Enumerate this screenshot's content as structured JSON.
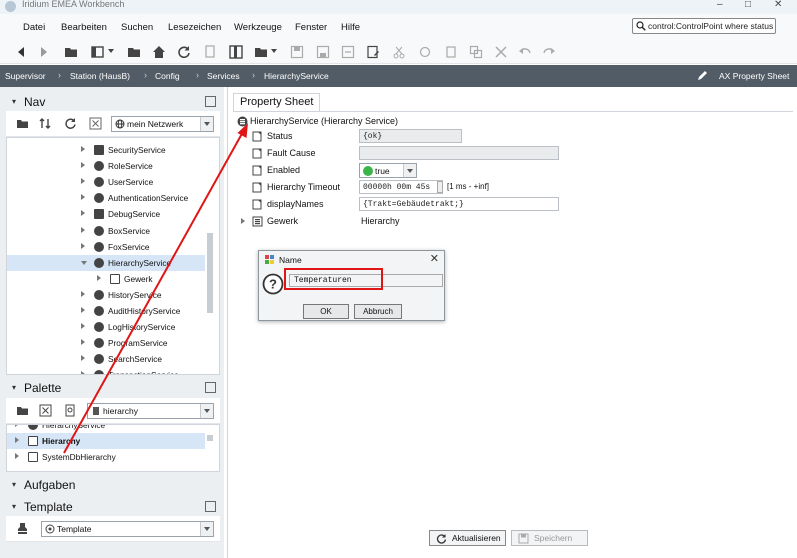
{
  "window": {
    "title": "Iridium EMEA Workbench"
  },
  "menu": [
    "Datei",
    "Bearbeiten",
    "Suchen",
    "Lesezeichen",
    "Werkzeuge",
    "Fenster",
    "Hilfe"
  ],
  "search": {
    "value": "control:ControlPoint where status"
  },
  "locator": {
    "crumbs": [
      "Supervisor",
      "Station (HausB)",
      "Config",
      "Services",
      "HierarchyService"
    ],
    "view": "AX Property Sheet"
  },
  "nav": {
    "title": "Nav",
    "network": "mein Netzwerk",
    "items": [
      {
        "label": "SecurityService"
      },
      {
        "label": "RoleService"
      },
      {
        "label": "UserService"
      },
      {
        "label": "AuthenticationService"
      },
      {
        "label": "DebugService"
      },
      {
        "label": "BoxService"
      },
      {
        "label": "FoxService"
      },
      {
        "label": "HierarchyService"
      },
      {
        "label": "Gewerk"
      },
      {
        "label": "HistoryService"
      },
      {
        "label": "AuditHistoryService"
      },
      {
        "label": "LogHistoryService"
      },
      {
        "label": "ProgramService"
      },
      {
        "label": "SearchService"
      },
      {
        "label": "TransactionService"
      }
    ]
  },
  "palette": {
    "title": "Palette",
    "module": "hierarchy",
    "items": [
      {
        "label": "HierarchyService"
      },
      {
        "label": "Hierarchy"
      },
      {
        "label": "SystemDbHierarchy"
      }
    ]
  },
  "aufgaben": {
    "title": "Aufgaben"
  },
  "template": {
    "title": "Template",
    "value": "Template"
  },
  "property_sheet": {
    "tab": "Property Sheet",
    "root": "HierarchyService  (Hierarchy Service)",
    "rows": [
      {
        "name": "Status",
        "value": "{ok}"
      },
      {
        "name": "Fault Cause",
        "value": ""
      },
      {
        "name": "Enabled",
        "value": "true"
      },
      {
        "name": "Hierarchy Timeout",
        "value": "00000h 00m 45s",
        "range": "[1 ms - +inf]"
      },
      {
        "name": "displayNames",
        "value": "{Trakt=Gebäudetrakt;}"
      },
      {
        "name": "Gewerk",
        "value": "Hierarchy"
      }
    ]
  },
  "dialog": {
    "title": "Name",
    "input_value": "Temperaturen",
    "ok_label": "OK",
    "cancel_label": "Abbruch"
  },
  "buttons": {
    "refresh": "Aktualisieren",
    "save": "Speichern"
  },
  "colors": {
    "accent_red": "#e01616",
    "locator_bg": "#525c66",
    "selection": "#d6e6f7",
    "enabled_green": "#3bb54a"
  }
}
